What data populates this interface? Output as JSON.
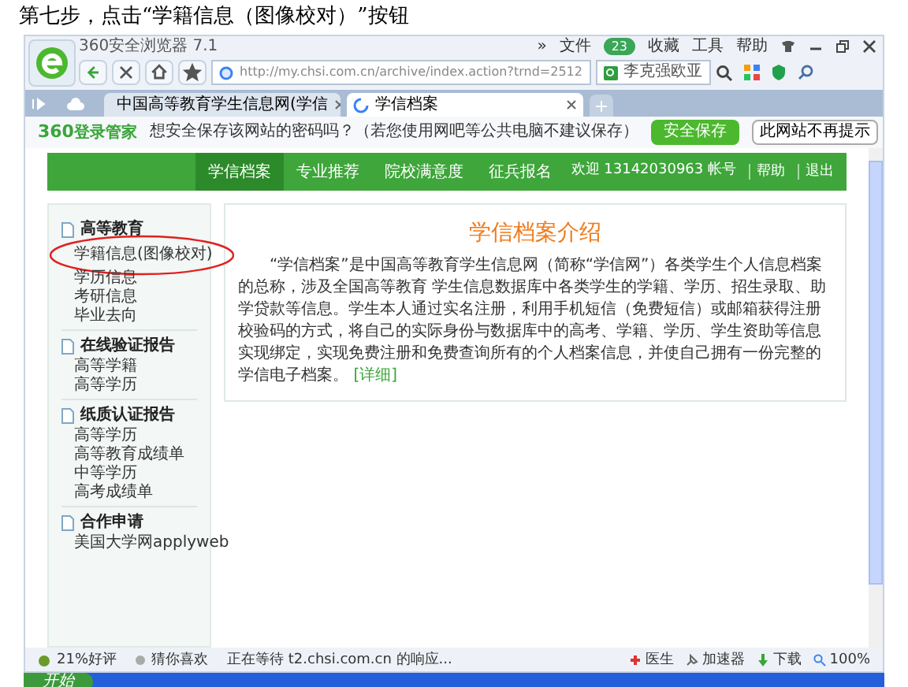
{
  "document_heading": "第七步，点击“学籍信息（图像校对）”按钮",
  "browser": {
    "title": "360安全浏览器 7.1",
    "menu": [
      "»",
      "文件",
      "收藏",
      "工具",
      "帮助"
    ],
    "badge": "23",
    "url": "http://my.chsi.com.cn/archive/index.action?trnd=2512",
    "search_value": "李克强欧亚"
  },
  "tabs": [
    {
      "label": "中国高等教育学生信息网(学信",
      "selected": false,
      "kind": "flag"
    },
    {
      "label": "学信档案",
      "selected": true,
      "kind": "loading"
    }
  ],
  "password_bar": {
    "logo": "360",
    "logo_text": "登录管家",
    "question": "想安全保存该网站的密码吗？",
    "note": "（若您使用网吧等公共电脑不建议保存）",
    "save_button": "安全保存",
    "never_button": "此网站不再提示"
  },
  "site_nav": {
    "items": [
      {
        "label": "学信档案",
        "selected": true
      },
      {
        "label": "专业推荐",
        "selected": false
      },
      {
        "label": "院校满意度",
        "selected": false
      },
      {
        "label": "征兵报名",
        "selected": false
      }
    ],
    "welcome": "欢迎 13142030963 帐号",
    "links": [
      "帮助",
      "退出"
    ]
  },
  "sidebar": [
    {
      "title": "高等教育",
      "items": [
        {
          "label": "学籍信息(图像校对)",
          "circled": true
        },
        {
          "label": "学历信息",
          "circled": false
        },
        {
          "label": "考研信息",
          "circled": false
        },
        {
          "label": "毕业去向",
          "circled": false
        }
      ]
    },
    {
      "title": "在线验证报告",
      "items": [
        {
          "label": "高等学籍",
          "circled": false
        },
        {
          "label": "高等学历",
          "circled": false
        }
      ]
    },
    {
      "title": "纸质认证报告",
      "items": [
        {
          "label": "高等学历",
          "circled": false
        },
        {
          "label": "高等教育成绩单",
          "circled": false
        },
        {
          "label": "中等学历",
          "circled": false
        },
        {
          "label": "高考成绩单",
          "circled": false
        }
      ]
    },
    {
      "title": "合作申请",
      "items": [
        {
          "label": "美国大学网applyweb",
          "circled": false
        }
      ]
    }
  ],
  "intro": {
    "title": "学信档案介绍",
    "text": "“学信档案”是中国高等教育学生信息网（简称“学信网”）各类学生个人信息档案的总称，涉及全国高等教育 学生信息数据库中各类学生的学籍、学历、招生录取、助学贷款等信息。学生本人通过实名注册，利用手机短信（免费短信）或邮箱获得注册校验码的方式，将自己的实际身份与数据库中的高考、学籍、学历、学生资助等信息实现绑定，实现免费注册和免费查询所有的个人档案信息，并使自己拥有一份完整的学信电子档案。",
    "more_link": "[详细]"
  },
  "status_bar": {
    "rating": "21%好评",
    "guess": "猜你喜欢",
    "status": "正在等待 t2.chsi.com.cn 的响应...",
    "tools": [
      "医生",
      "加速器",
      "下载"
    ],
    "zoom": "100%"
  },
  "taskbar": {
    "start": "开始"
  }
}
